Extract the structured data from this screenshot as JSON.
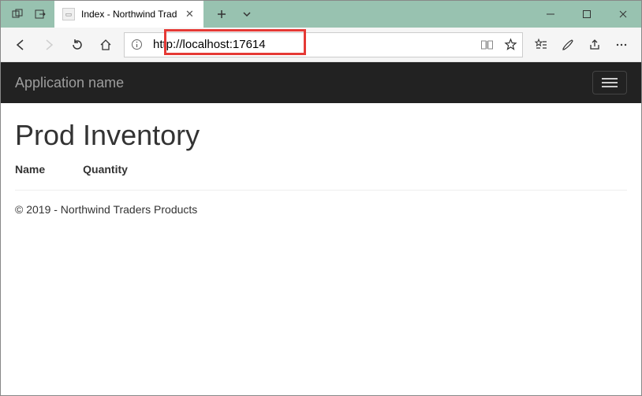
{
  "window": {
    "tab_title": "Index - Northwind Trad",
    "address_url": "http://localhost:17614"
  },
  "navbar": {
    "brand": "Application name"
  },
  "page": {
    "heading": "Prod Inventory",
    "columns": {
      "name": "Name",
      "quantity": "Quantity"
    },
    "footer": "© 2019 - Northwind Traders Products"
  }
}
